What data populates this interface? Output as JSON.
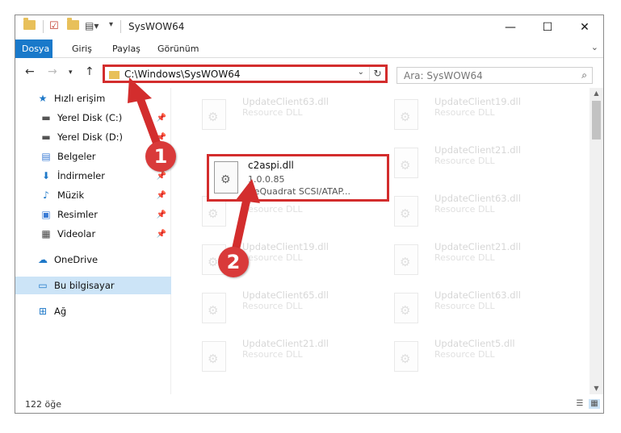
{
  "window": {
    "title": "SysWOW64"
  },
  "ribbon": {
    "tabs": [
      "Dosya",
      "Giriş",
      "Paylaş",
      "Görünüm"
    ]
  },
  "address": {
    "path": "C:\\Windows\\SysWOW64"
  },
  "search": {
    "placeholder": "Ara: SysWOW64"
  },
  "nav_pane": {
    "items": [
      {
        "label": "Hızlı erişim",
        "icon": "star-icon"
      },
      {
        "label": "Yerel Disk (C:)",
        "icon": "drive-icon",
        "pinned": true
      },
      {
        "label": "Yerel Disk (D:)",
        "icon": "drive-icon",
        "pinned": true
      },
      {
        "label": "Belgeler",
        "icon": "document-icon",
        "pinned": true
      },
      {
        "label": "İndirmeler",
        "icon": "download-icon",
        "pinned": true
      },
      {
        "label": "Müzik",
        "icon": "music-icon",
        "pinned": true
      },
      {
        "label": "Resimler",
        "icon": "pictures-icon",
        "pinned": true
      },
      {
        "label": "Videolar",
        "icon": "video-icon",
        "pinned": true
      },
      {
        "label": "OneDrive",
        "icon": "cloud-icon"
      },
      {
        "label": "Bu bilgisayar",
        "icon": "computer-icon",
        "selected": true
      },
      {
        "label": "Ağ",
        "icon": "network-icon"
      }
    ]
  },
  "files": {
    "faded": [
      {
        "name": "UpdateClient63.dll",
        "desc": "Resource DLL"
      },
      {
        "name": "UpdateClient19.dll",
        "desc": "Resource DLL"
      },
      {
        "name": "UpdateClient21.dll",
        "desc": "Resource DLL"
      },
      {
        "name": "UpdateClient19.dll",
        "desc": "Resource DLL"
      },
      {
        "name": "UpdateClient63.dll",
        "desc": "Resource DLL"
      },
      {
        "name": "UpdateClient19.dll",
        "desc": "Resource DLL"
      },
      {
        "name": "UpdateClient21.dll",
        "desc": "Resource DLL"
      },
      {
        "name": "UpdateClient65.dll",
        "desc": "Resource DLL"
      },
      {
        "name": "UpdateClient63.dll",
        "desc": "Resource DLL"
      },
      {
        "name": "UpdateClient21.dll",
        "desc": "Resource DLL"
      },
      {
        "name": "UpdateClient5.dll",
        "desc": "Resource DLL"
      }
    ],
    "highlighted": {
      "name": "c2aspi.dll",
      "version": "1.0.0.85",
      "desc": "CeQuadrat SCSI/ATAP..."
    }
  },
  "status": {
    "count": "122 öğe"
  },
  "annotations": {
    "badge1": "1",
    "badge2": "2",
    "color": "#d32d2d"
  }
}
